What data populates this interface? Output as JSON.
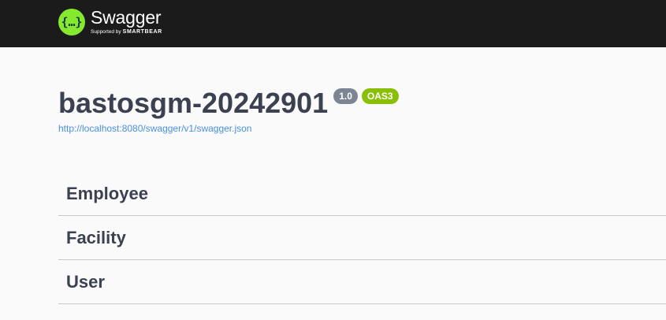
{
  "topbar": {
    "logo": {
      "icon": "swagger-braces-icon",
      "name": "Swagger",
      "tagline_prefix": "Supported by",
      "tagline_brand": "SMARTBEAR",
      "accent_color": "#85ea2d"
    }
  },
  "info": {
    "title": "bastosgm-20242901",
    "version_badge": "1.0",
    "spec_badge": "OAS3",
    "spec_url": "http://localhost:8080/swagger/v1/swagger.json",
    "colors": {
      "version_badge": "#7d8492",
      "spec_badge": "#89bf04",
      "link": "#4990e2"
    }
  },
  "tags": [
    {
      "name": "Employee"
    },
    {
      "name": "Facility"
    },
    {
      "name": "User"
    }
  ]
}
